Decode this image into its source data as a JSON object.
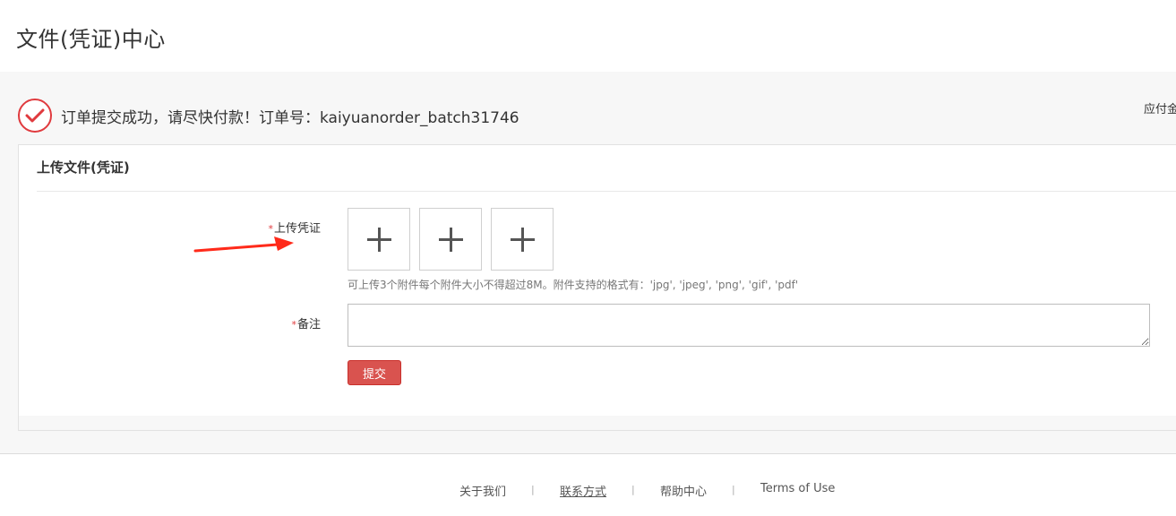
{
  "page": {
    "title": "文件(凭证)中心"
  },
  "order": {
    "success_message": "订单提交成功，请尽快付款！订单号：kaiyuanorder_batch31746",
    "due_amount_label": "应付金",
    "status_color": "#e03a3e"
  },
  "upload_card": {
    "title": "上传文件(凭证)",
    "voucher_label": "上传凭证",
    "required_mark": "*",
    "upload_slots": [
      "plus-icon",
      "plus-icon",
      "plus-icon"
    ],
    "hint": "可上传3个附件每个附件大小不得超过8M。附件支持的格式有：'jpg', 'jpeg', 'png', 'gif', 'pdf'",
    "remark_label": "备注",
    "remark_value": "",
    "submit_label": "提交",
    "submit_color": "#d9534f"
  },
  "footer": {
    "links": [
      {
        "label": "关于我们"
      },
      {
        "label": "联系方式"
      },
      {
        "label": "帮助中心"
      },
      {
        "label": "Terms of Use"
      }
    ],
    "separator": "|"
  }
}
